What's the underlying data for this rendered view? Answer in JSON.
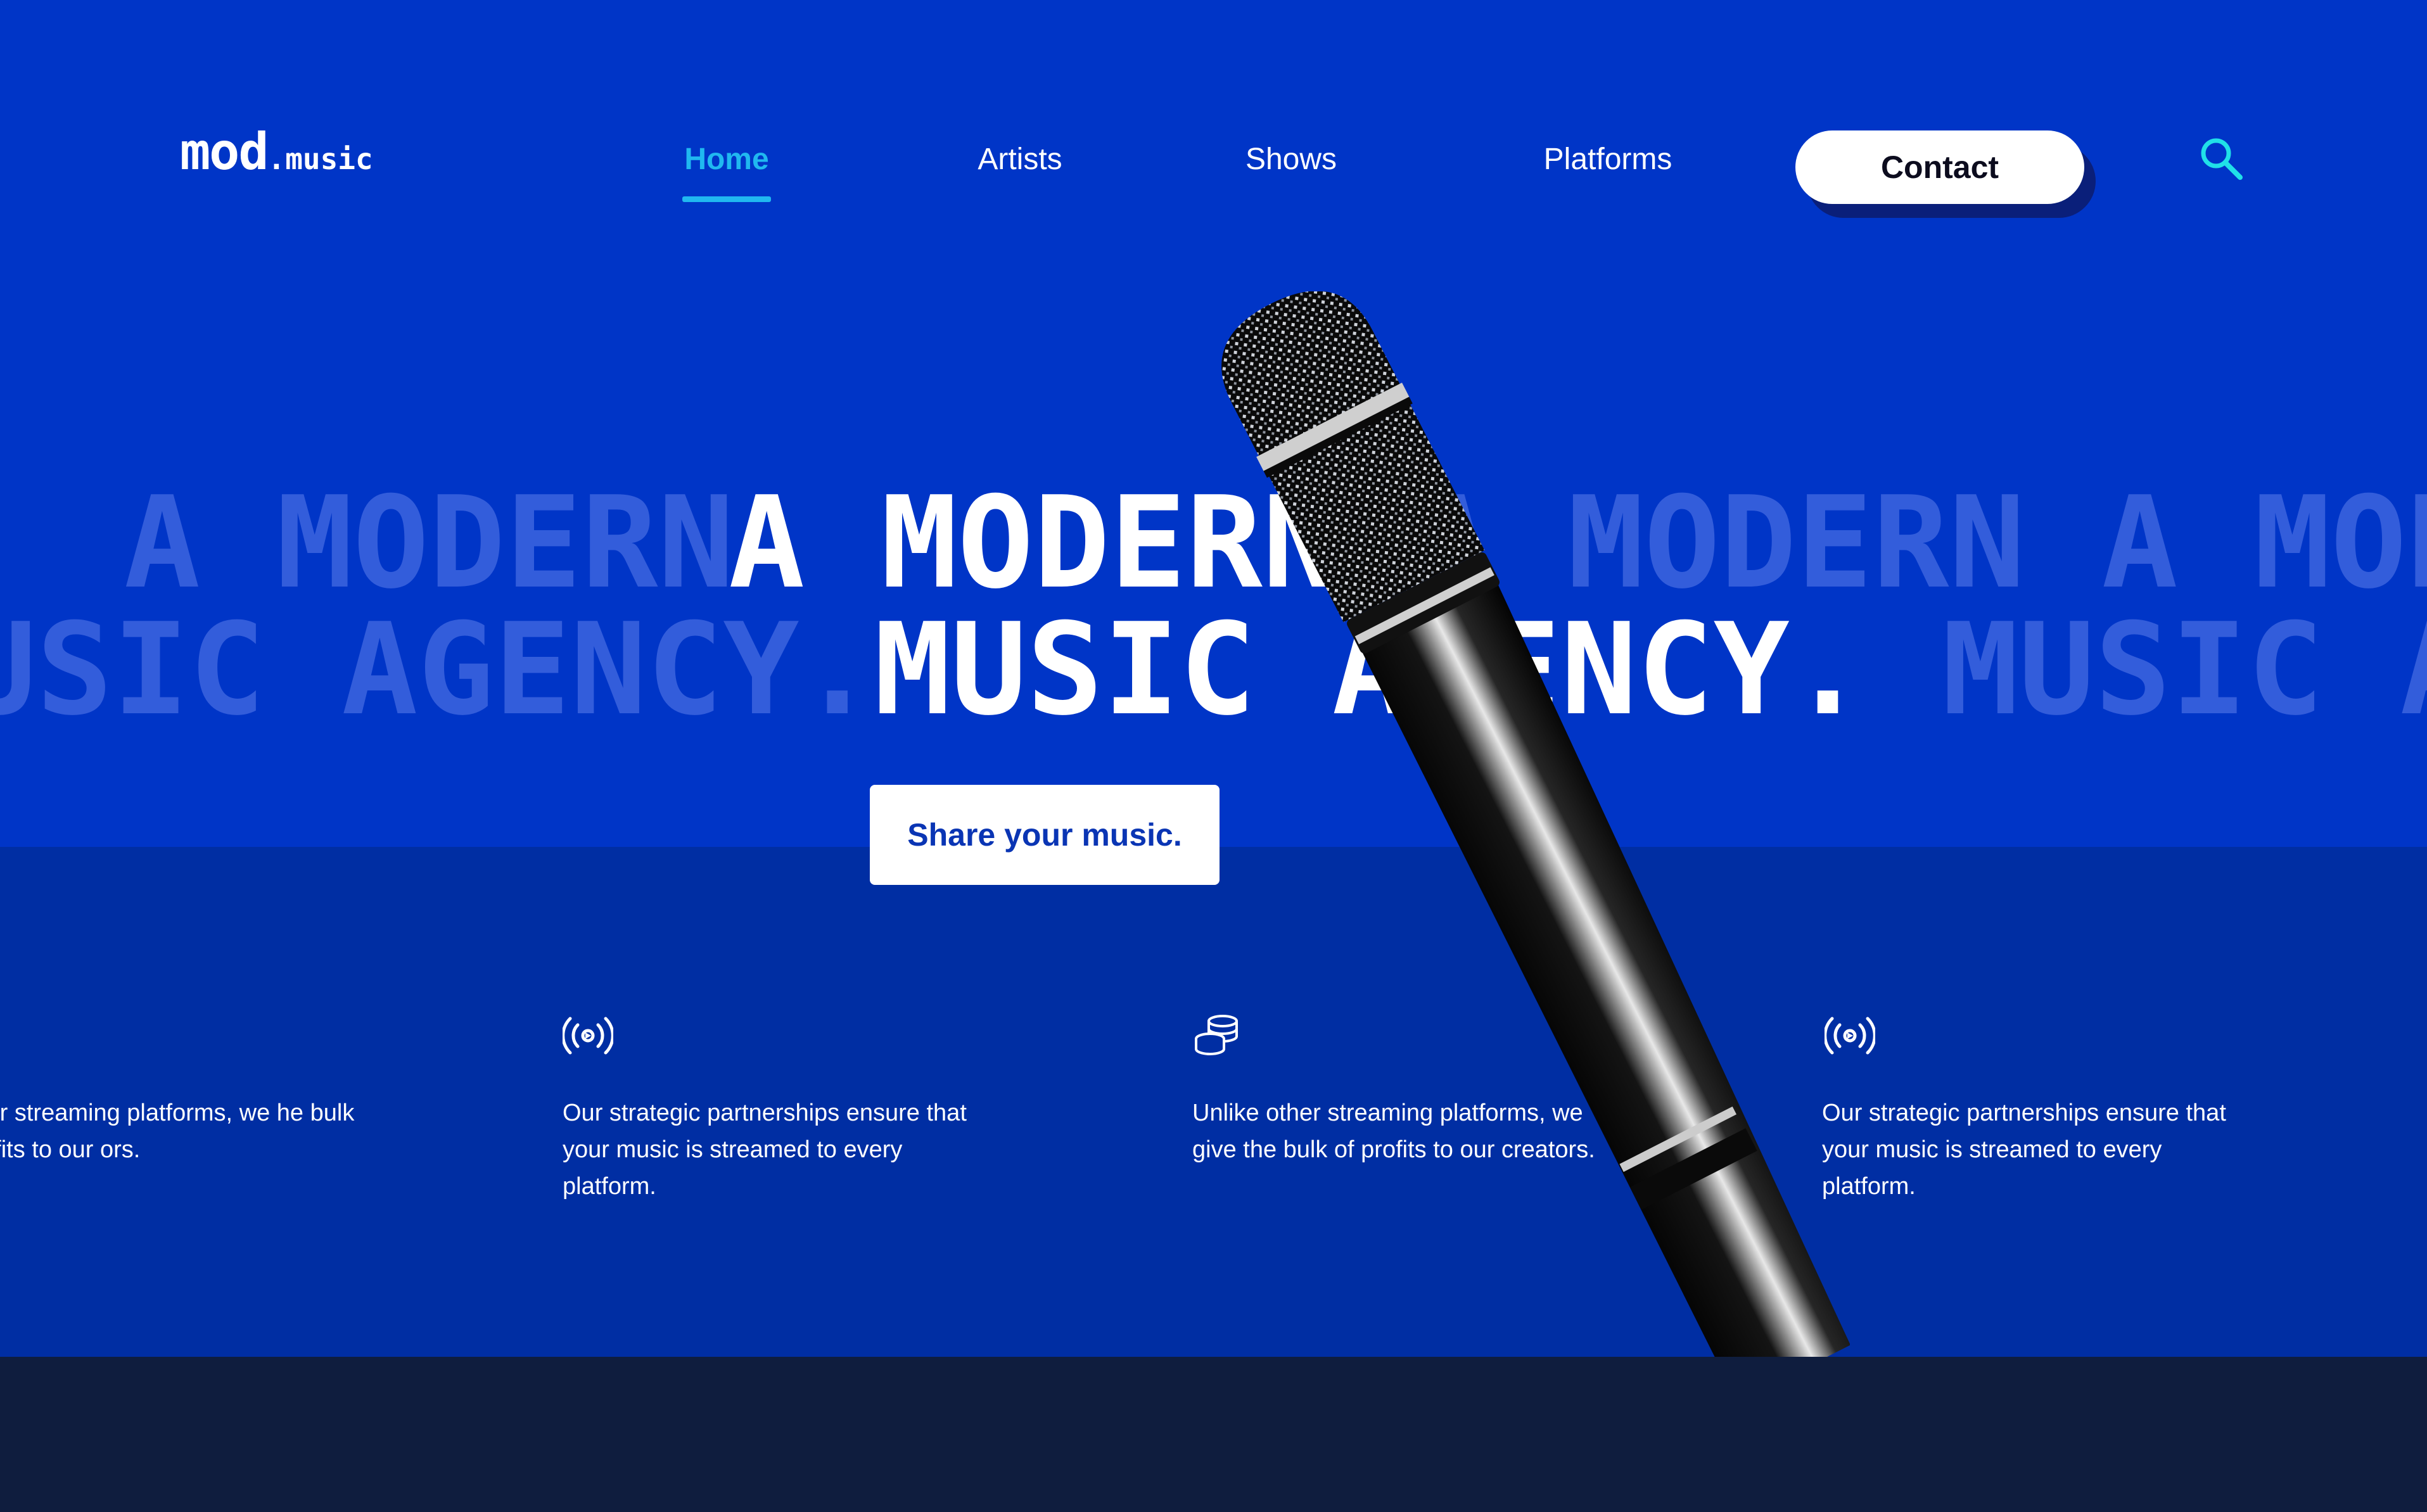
{
  "logo": {
    "primary": "mod",
    "secondary": ".music"
  },
  "nav": {
    "items": [
      {
        "label": "Home",
        "active": true
      },
      {
        "label": "Artists",
        "active": false
      },
      {
        "label": "Shows",
        "active": false
      },
      {
        "label": "Platforms",
        "active": false
      }
    ],
    "contact_label": "Contact",
    "search_icon": "search-icon"
  },
  "hero": {
    "line1": {
      "ghost_left": "A MODERN ",
      "text": "A MODERN",
      "ghost_right": " A MODERN A MODERN"
    },
    "line2": {
      "ghost_left": "USIC AGENCY. ",
      "text": "MUSIC AGENCY.",
      "ghost_right": " MUSIC AGENCY."
    },
    "cta_label": "Share your music."
  },
  "features": [
    {
      "icon": "",
      "text": "e other streaming platforms, we he bulk of profits to our ors."
    },
    {
      "icon": "broadcast-icon",
      "text": "Our strategic partnerships ensure that your music is streamed to every platform."
    },
    {
      "icon": "coins-icon",
      "text": "Unlike other streaming platforms, we give the bulk of profits to our creators."
    },
    {
      "icon": "broadcast-icon",
      "text": "Our strategic partnerships ensure that your music is streamed to every platform."
    }
  ],
  "colors": {
    "hero_bg": "#0035c7",
    "features_bg": "#002ea3",
    "footer_bg": "#0f1d3e",
    "accent": "#20b8f0",
    "cta_text": "#0a35b4"
  }
}
